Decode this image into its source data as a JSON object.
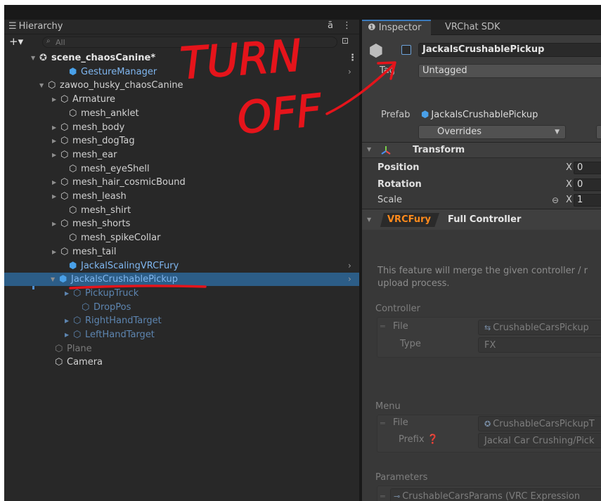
{
  "hierarchy": {
    "tab_label": "Hierarchy",
    "search_placeholder": "All",
    "add_symbol": "+▾",
    "rows": [
      {
        "label": "scene_chaosCanine*",
        "kind": "scene"
      },
      {
        "label": "GestureManager",
        "kind": "prefab"
      },
      {
        "label": "zawoo_husky_chaosCanine",
        "kind": "object"
      },
      {
        "label": "Armature",
        "kind": "object"
      },
      {
        "label": "mesh_anklet",
        "kind": "object"
      },
      {
        "label": "mesh_body",
        "kind": "object"
      },
      {
        "label": "mesh_dogTag",
        "kind": "object"
      },
      {
        "label": "mesh_ear",
        "kind": "object"
      },
      {
        "label": "mesh_eyeShell",
        "kind": "object"
      },
      {
        "label": "mesh_hair_cosmicBound",
        "kind": "object"
      },
      {
        "label": "mesh_leash",
        "kind": "object"
      },
      {
        "label": "mesh_shirt",
        "kind": "object"
      },
      {
        "label": "mesh_shorts",
        "kind": "object"
      },
      {
        "label": "mesh_spikeCollar",
        "kind": "object"
      },
      {
        "label": "mesh_tail",
        "kind": "object"
      },
      {
        "label": "JackalScalingVRCFury",
        "kind": "prefab"
      },
      {
        "label": "JackalsCrushablePickup",
        "kind": "prefab-selected"
      },
      {
        "label": "PickupTruck",
        "kind": "child-dim"
      },
      {
        "label": "DropPos",
        "kind": "child-dim"
      },
      {
        "label": "RightHandTarget",
        "kind": "child-dim"
      },
      {
        "label": "LeftHandTarget",
        "kind": "child-dim"
      },
      {
        "label": "Plane",
        "kind": "disabled"
      },
      {
        "label": "Camera",
        "kind": "object"
      }
    ]
  },
  "inspector": {
    "tab_label": "Inspector",
    "tab2_label": "VRChat SDK",
    "object_name": "JackalsCrushablePickup",
    "active": false,
    "tag_label": "Tag",
    "tag_value": "Untagged",
    "prefab_label": "Prefab",
    "prefab_value": "JackalsCrushablePickup",
    "overrides_label": "Overrides",
    "transform": {
      "title": "Transform",
      "position_label": "Position",
      "position_x": "0",
      "rotation_label": "Rotation",
      "rotation_x": "0",
      "scale_label": "Scale",
      "scale_x": "1",
      "axis_label": "X"
    },
    "vrcfury": {
      "badge": "VRCFury",
      "title": "Full Controller",
      "description_line1": "This feature will merge the given controller / r",
      "description_line2": "upload process.",
      "controller_section": "Controller",
      "file_label": "File",
      "controller_file": "CrushableCarsPickup",
      "type_label": "Type",
      "type_value": "FX",
      "menu_section": "Menu",
      "menu_file_label": "File",
      "menu_file": "CrushableCarsPickupT",
      "prefix_label": "Prefix",
      "prefix_value": "Jackal Car Crushing/Pick",
      "parameters_section": "Parameters",
      "params_value": "CrushableCarsParams (VRC Expression"
    }
  },
  "annotation": {
    "line1": "TURN",
    "line2": "OFF",
    "color": "#e5141b"
  },
  "colors": {
    "panel_bg": "#282828",
    "inspector_bg": "#383838",
    "selection": "#2c5d87",
    "prefab_text": "#7fb6ef",
    "vrcfury_orange": "#ff8a1c"
  }
}
